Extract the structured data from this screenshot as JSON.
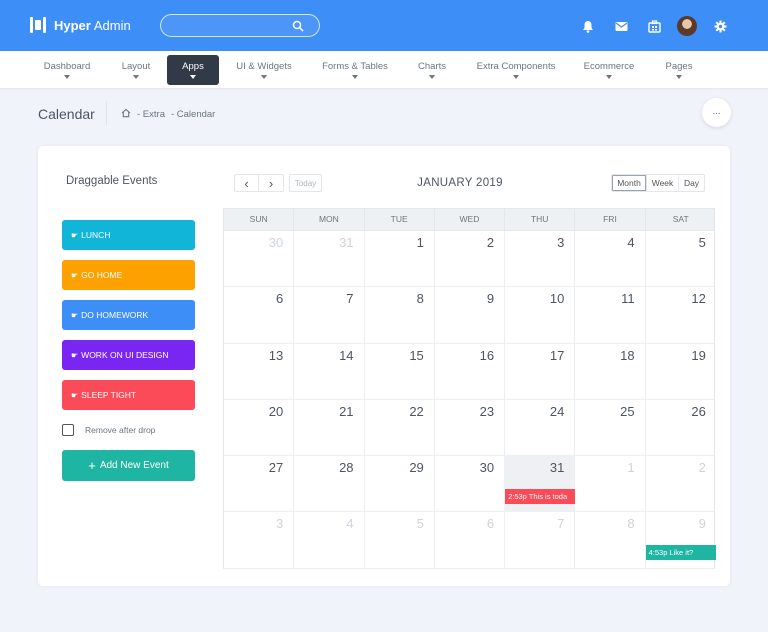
{
  "app": {
    "brand_bold": "Hyper",
    "brand_light": "Admin",
    "search_placeholder": "",
    "accent": "#3e8ef7"
  },
  "top_icons": [
    "bell-icon",
    "mail-icon",
    "app-grid-icon",
    "avatar",
    "gear-icon"
  ],
  "nav": [
    {
      "label": "Dashboard",
      "active": false
    },
    {
      "label": "Layout",
      "active": false
    },
    {
      "label": "Apps",
      "active": true
    },
    {
      "label": "UI & Widgets",
      "active": false
    },
    {
      "label": "Forms & Tables",
      "active": false
    },
    {
      "label": "Charts",
      "active": false
    },
    {
      "label": "Extra Components",
      "active": false
    },
    {
      "label": "Ecommerce",
      "active": false
    },
    {
      "label": "Pages",
      "active": false
    }
  ],
  "page": {
    "title": "Calendar",
    "breadcrumb": [
      "- Extra",
      "- Calendar"
    ],
    "more_label": "..."
  },
  "sidebar": {
    "title": "Draggable Events",
    "events": [
      {
        "label": "LUNCH",
        "color": "#11b5d8"
      },
      {
        "label": "GO HOME",
        "color": "#fda100"
      },
      {
        "label": "DO HOMEWORK",
        "color": "#3e8ef7"
      },
      {
        "label": "WORK ON UI DESIGN",
        "color": "#7a26f2"
      },
      {
        "label": "SLEEP TIGHT",
        "color": "#fb4b58"
      }
    ],
    "remove_label": "Remove after drop",
    "add_button": "Add New Event"
  },
  "calendar": {
    "prev_label": "‹",
    "next_label": "›",
    "today_label": "Today",
    "title": "JANUARY 2019",
    "views": [
      "Month",
      "Week",
      "Day"
    ],
    "active_view": "Month",
    "weekdays": [
      "SUN",
      "MON",
      "TUE",
      "WED",
      "THU",
      "FRI",
      "SAT"
    ],
    "weeks": [
      [
        {
          "d": "30",
          "other": true
        },
        {
          "d": "31",
          "other": true
        },
        {
          "d": "1"
        },
        {
          "d": "2"
        },
        {
          "d": "3"
        },
        {
          "d": "4"
        },
        {
          "d": "5"
        }
      ],
      [
        {
          "d": "6"
        },
        {
          "d": "7"
        },
        {
          "d": "8"
        },
        {
          "d": "9"
        },
        {
          "d": "10"
        },
        {
          "d": "11"
        },
        {
          "d": "12"
        }
      ],
      [
        {
          "d": "13"
        },
        {
          "d": "14"
        },
        {
          "d": "15"
        },
        {
          "d": "16"
        },
        {
          "d": "17"
        },
        {
          "d": "18"
        },
        {
          "d": "19"
        }
      ],
      [
        {
          "d": "20"
        },
        {
          "d": "21"
        },
        {
          "d": "22"
        },
        {
          "d": "23"
        },
        {
          "d": "24"
        },
        {
          "d": "25"
        },
        {
          "d": "26"
        }
      ],
      [
        {
          "d": "27"
        },
        {
          "d": "28"
        },
        {
          "d": "29"
        },
        {
          "d": "30"
        },
        {
          "d": "31",
          "today": true,
          "event": {
            "text": "2:53p This is toda",
            "color": "#fb4b58"
          }
        },
        {
          "d": "1",
          "other": true
        },
        {
          "d": "2",
          "other": true
        }
      ],
      [
        {
          "d": "3",
          "other": true
        },
        {
          "d": "4",
          "other": true
        },
        {
          "d": "5",
          "other": true
        },
        {
          "d": "6",
          "other": true
        },
        {
          "d": "7",
          "other": true
        },
        {
          "d": "8",
          "other": true
        },
        {
          "d": "9",
          "other": true,
          "event": {
            "text": "4:53p Like it?",
            "color": "#1fb5a3"
          }
        }
      ]
    ]
  }
}
